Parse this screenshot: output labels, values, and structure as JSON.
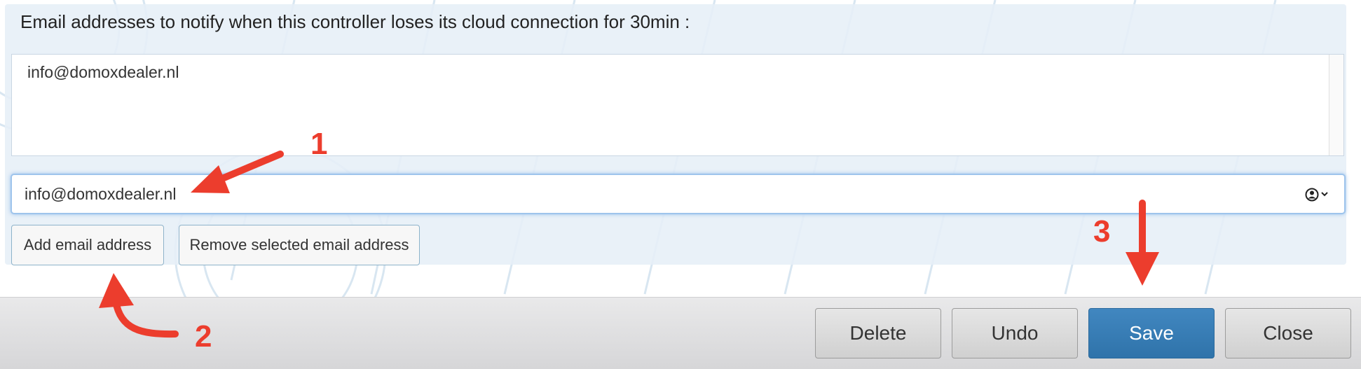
{
  "form": {
    "label": "Email addresses to notify when this controller loses its cloud connection for 30min :",
    "email_list": [
      "info@domoxdealer.nl"
    ],
    "email_input_value": "info@domoxdealer.nl",
    "add_button": "Add email address",
    "remove_button": "Remove selected email address"
  },
  "footer": {
    "delete": "Delete",
    "undo": "Undo",
    "save": "Save",
    "close": "Close"
  },
  "annotations": {
    "step1": "1",
    "step2": "2",
    "step3": "3",
    "color": "#ec3d2d"
  },
  "icons": {
    "input_icon": "contact-card-icon",
    "chevron": "chevron-down-icon"
  }
}
